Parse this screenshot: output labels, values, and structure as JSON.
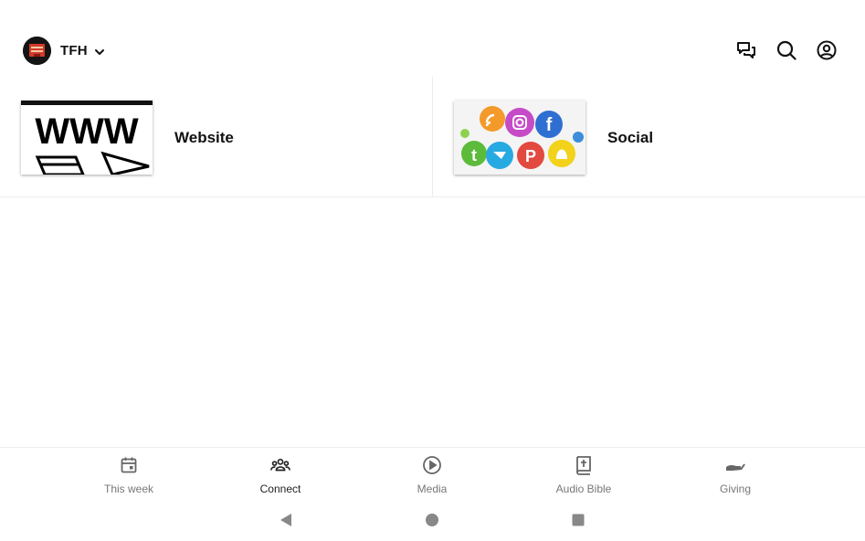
{
  "header": {
    "org_name": "TFH",
    "icons": {
      "logo": "church-logo",
      "chevron": "chevron-down-icon",
      "chat": "chat-icon",
      "search": "search-icon",
      "profile": "profile-icon"
    }
  },
  "cards": [
    {
      "label": "Website",
      "thumbnail_text": "WWW"
    },
    {
      "label": "Social"
    }
  ],
  "bottom_nav": {
    "tabs": [
      {
        "label": "This week",
        "icon": "calendar-icon",
        "active": false
      },
      {
        "label": "Connect",
        "icon": "people-icon",
        "active": true
      },
      {
        "label": "Media",
        "icon": "play-circle-icon",
        "active": false
      },
      {
        "label": "Audio Bible",
        "icon": "bible-icon",
        "active": false
      },
      {
        "label": "Giving",
        "icon": "giving-hand-icon",
        "active": false
      }
    ]
  },
  "system_nav": {
    "icons": [
      "back-icon",
      "home-icon",
      "recents-icon"
    ]
  },
  "colors": {
    "background": "#ffffff",
    "text": "#111111",
    "inactive_tab": "#777777",
    "divider": "#ececec",
    "logo_red": "#d23a2a"
  }
}
